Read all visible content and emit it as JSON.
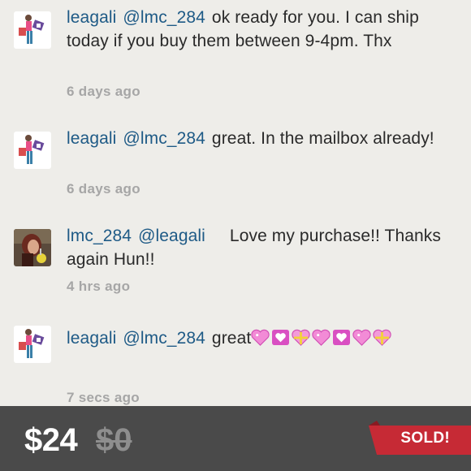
{
  "comments": [
    {
      "user": "leagali",
      "mention": "@lmc_284",
      "text": "ok ready for you. I can ship today if you buy them between 9-4pm. Thx",
      "time": "6 days ago"
    },
    {
      "user": "leagali",
      "mention": "@lmc_284",
      "text": "great. In the mailbox already!",
      "time": "6 days ago"
    },
    {
      "user": "lmc_284",
      "mention": "@leagali",
      "text": "Love my purchase!! Thanks again Hun!!",
      "time": "4 hrs ago"
    },
    {
      "user": "leagali",
      "mention": "@lmc_284",
      "text": "great",
      "hearts": [
        "sparkling-heart-icon",
        "heart-box-icon",
        "gift-heart-icon",
        "sparkling-heart-icon",
        "heart-box-icon",
        "sparkling-heart-icon",
        "gift-heart-icon"
      ],
      "time": "7 secs ago"
    }
  ],
  "listing": {
    "price": "$24",
    "original_price": "$0",
    "status": "SOLD!"
  },
  "colors": {
    "username": "#1e5a86",
    "background": "#eeede9",
    "footer": "#4a4a4a",
    "sold_ribbon": "#c62a35"
  }
}
